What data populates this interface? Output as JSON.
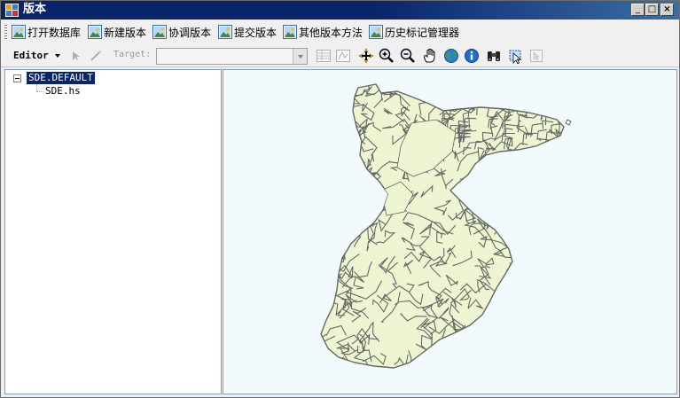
{
  "window": {
    "title": "版本",
    "minimize": "_",
    "maximize": "□",
    "close": "×"
  },
  "menu": {
    "items": [
      {
        "label": "打开数据库"
      },
      {
        "label": "新建版本"
      },
      {
        "label": "协调版本"
      },
      {
        "label": "提交版本"
      },
      {
        "label": "其他版本方法"
      },
      {
        "label": "历史标记管理器"
      }
    ]
  },
  "toolbar": {
    "editor_label": "Editor",
    "target_label": "Target:",
    "target_value": ""
  },
  "tree": {
    "root": "SDE.DEFAULT",
    "child": "SDE.hs"
  },
  "colors": {
    "map_background": "#f3fafd",
    "parcel_fill": "#eef5d3",
    "parcel_line": "#646a62",
    "selection": "#0a246a"
  }
}
